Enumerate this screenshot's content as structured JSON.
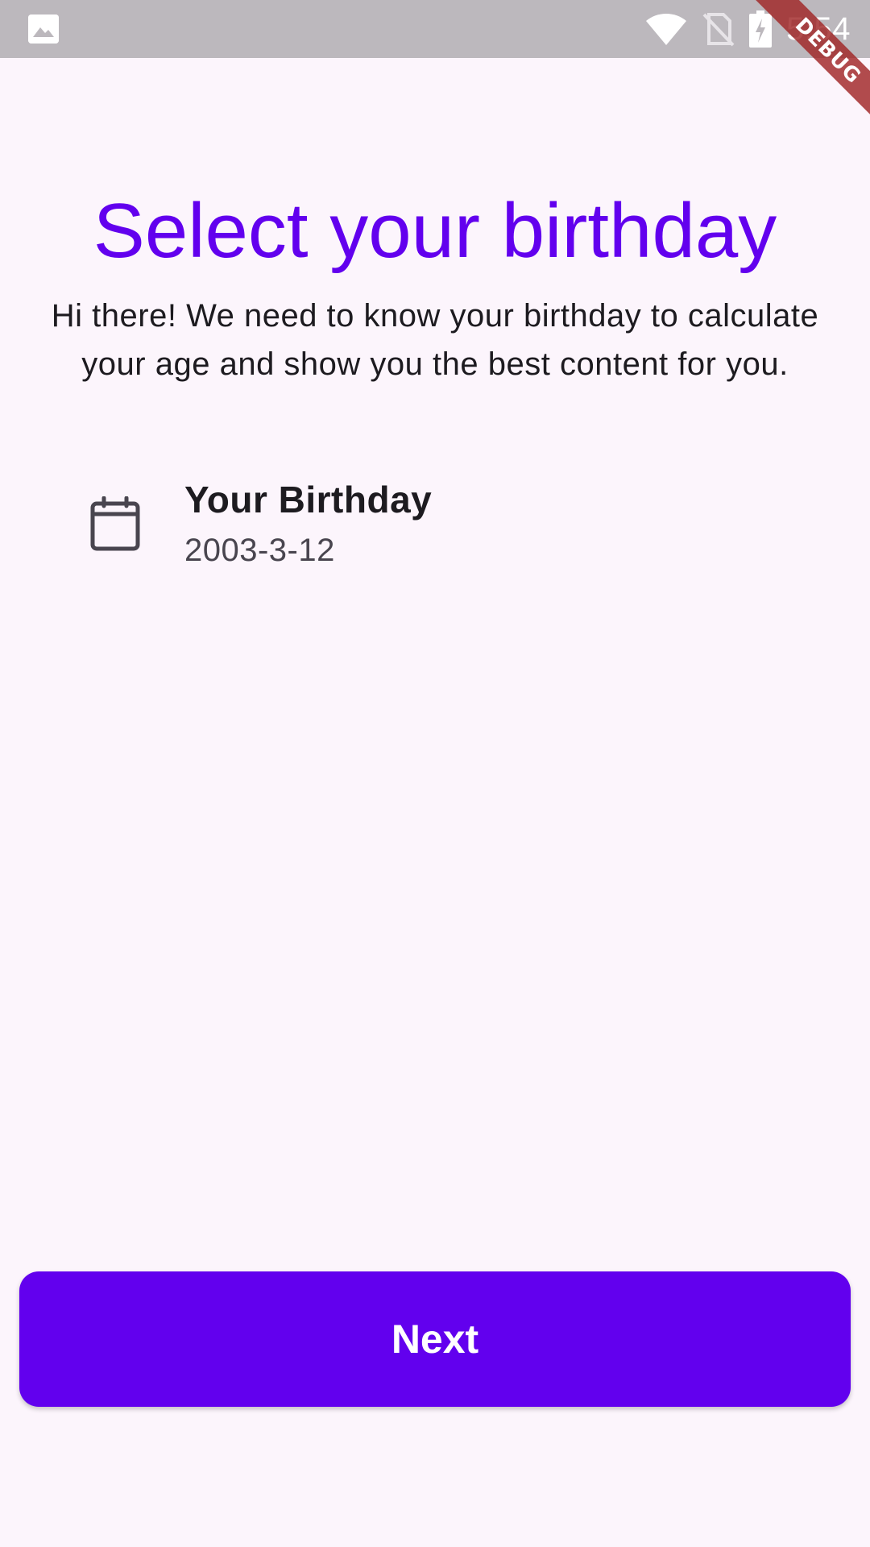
{
  "status_bar": {
    "time": "5:54",
    "icons": [
      "image-icon",
      "wifi-icon",
      "no-sim-icon",
      "battery-charging-icon"
    ]
  },
  "debug_banner": {
    "label": "DEBUG"
  },
  "page": {
    "title": "Select your birthday",
    "description": "Hi there! We need to know your birthday to calculate your age and show you the best content for you."
  },
  "birthday_tile": {
    "icon": "calendar-icon",
    "title": "Your Birthday",
    "value": "2003-3-12"
  },
  "actions": {
    "next_label": "Next"
  },
  "colors": {
    "primary": "#6200ee",
    "background": "#fcf5fc",
    "status_bar": "#bcb8bd",
    "debug_ribbon": "#a02626"
  }
}
